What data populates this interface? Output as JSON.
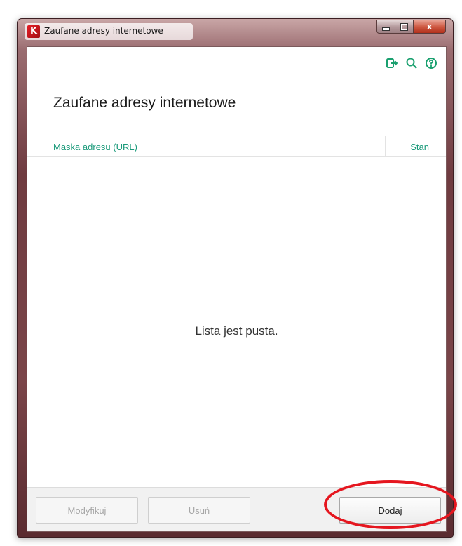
{
  "window": {
    "title": "Zaufane adresy internetowe",
    "controls": {
      "minimize": "minimize",
      "maximize": "maximize",
      "close": "x"
    }
  },
  "toolbar": {
    "icons": [
      "exit-icon",
      "search-icon",
      "help-icon"
    ]
  },
  "page": {
    "title": "Zaufane adresy internetowe"
  },
  "table": {
    "columns": [
      "Maska adresu (URL)",
      "Stan"
    ],
    "empty_message": "Lista jest pusta."
  },
  "buttons": {
    "modify": "Modyfikuj",
    "delete": "Usuń",
    "add": "Dodaj"
  },
  "colors": {
    "accent": "#1a9a7a",
    "highlight": "#e5161f"
  }
}
